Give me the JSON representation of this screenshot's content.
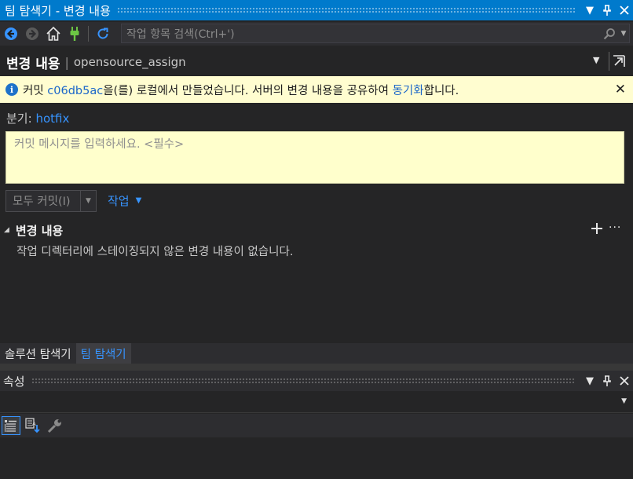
{
  "window": {
    "title": "팀 탐색기 - 변경 내용",
    "dropdown_icon": "caret-down-icon",
    "pin_icon": "pin-icon",
    "close_icon": "close-icon"
  },
  "toolbar": {
    "icons": [
      "back-arrow-icon",
      "forward-arrow-icon",
      "home-icon",
      "connect-plug-icon",
      "refresh-icon"
    ],
    "search_placeholder": "작업 항목 검색(Ctrl+')"
  },
  "header": {
    "title": "변경 내용",
    "separator": "|",
    "repo": "opensource_assign"
  },
  "infobar": {
    "prefix": "커밋 ",
    "commit_id": "c06db5ac",
    "middle": "을(를) 로컬에서 만들었습니다. 서버의 변경 내용을 공유하여 ",
    "sync_link": "동기화",
    "suffix": "합니다.",
    "close_glyph": "✕"
  },
  "branch": {
    "label": "분기: ",
    "name": "hotfix"
  },
  "commit_message": {
    "placeholder": "커밋 메시지를 입력하세요. <필수>",
    "value": ""
  },
  "actions": {
    "commit_all": "모두 커밋(I)",
    "more_actions": "작업"
  },
  "changes_section": {
    "title": "변경 내용",
    "empty_message": "작업 디렉터리에 스테이징되지 않은 변경 내용이 없습니다."
  },
  "tabs": [
    {
      "label": "솔루션 탐색기",
      "active": false
    },
    {
      "label": "팀 탐색기",
      "active": true
    }
  ],
  "properties": {
    "title": "속성",
    "tool_icons": [
      "categorized-icon",
      "sort-alphabetical-icon",
      "property-pages-wrench-icon"
    ]
  },
  "colors": {
    "accent": "#007acc",
    "link": "#3794ff",
    "info_bg": "#fffdd0",
    "commit_bg": "#ffffcc"
  }
}
